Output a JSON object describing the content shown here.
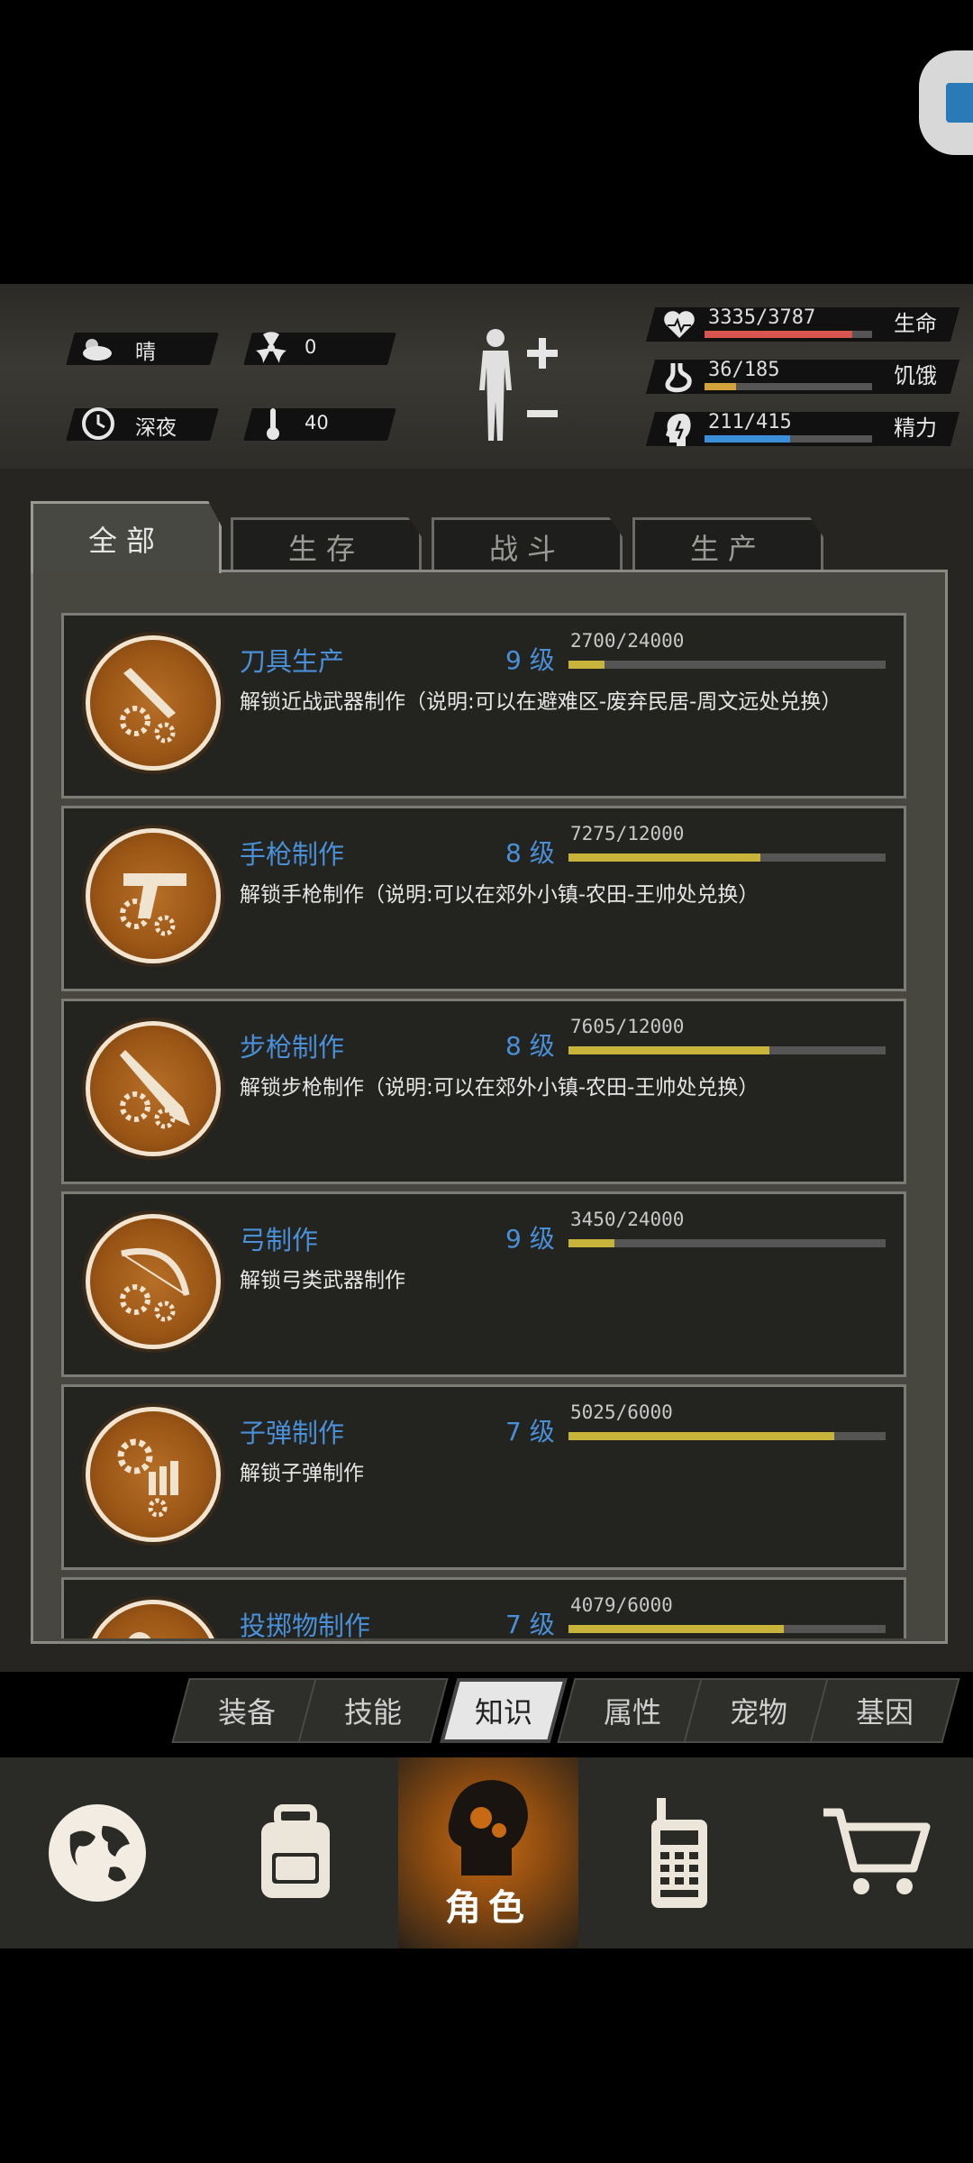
{
  "status": {
    "weather": "晴",
    "radiation": "0",
    "time_of_day": "深夜",
    "temperature": "40",
    "bars": [
      {
        "name": "生命",
        "value_text": "3335/3787",
        "fraction": 0.88,
        "color": "#d9534f",
        "icon": "heart-icon"
      },
      {
        "name": "饥饿",
        "value_text": "36/185",
        "fraction": 0.19,
        "color": "#d4a23a",
        "icon": "stomach-icon"
      },
      {
        "name": "精力",
        "value_text": "211/415",
        "fraction": 0.51,
        "color": "#3a8fd8",
        "icon": "brain-icon"
      }
    ]
  },
  "category_tabs": [
    {
      "label": "全部",
      "active": true
    },
    {
      "label": "生存",
      "active": false
    },
    {
      "label": "战斗",
      "active": false
    },
    {
      "label": "生产",
      "active": false
    }
  ],
  "skills": [
    {
      "name": "刀具生产",
      "level": "9 级",
      "progress_text": "2700/24000",
      "fraction": 0.1125,
      "desc": "解锁近战武器制作（说明:可以在避难区-废弃民居-周文远处兑换）",
      "icon": "knife-gear-icon"
    },
    {
      "name": "手枪制作",
      "level": "8 级",
      "progress_text": "7275/12000",
      "fraction": 0.606,
      "desc": "解锁手枪制作（说明:可以在郊外小镇-农田-王帅处兑换）",
      "icon": "pistol-gear-icon"
    },
    {
      "name": "步枪制作",
      "level": "8 级",
      "progress_text": "7605/12000",
      "fraction": 0.634,
      "desc": "解锁步枪制作（说明:可以在郊外小镇-农田-王帅处兑换）",
      "icon": "rifle-gear-icon"
    },
    {
      "name": "弓制作",
      "level": "9 级",
      "progress_text": "3450/24000",
      "fraction": 0.144,
      "desc": "解锁弓类武器制作",
      "icon": "bow-gear-icon"
    },
    {
      "name": "子弹制作",
      "level": "7 级",
      "progress_text": "5025/6000",
      "fraction": 0.8375,
      "desc": "解锁子弹制作",
      "icon": "bullet-gear-icon"
    },
    {
      "name": "投掷物制作",
      "level": "7 级",
      "progress_text": "4079/6000",
      "fraction": 0.68,
      "desc": "",
      "icon": "grenade-gear-icon"
    }
  ],
  "sub_tabs": [
    {
      "label": "装备",
      "active": false
    },
    {
      "label": "技能",
      "active": false
    },
    {
      "label": "知识",
      "active": true
    },
    {
      "label": "属性",
      "active": false
    },
    {
      "label": "宠物",
      "active": false
    },
    {
      "label": "基因",
      "active": false
    }
  ],
  "bottom_nav": [
    {
      "label": "",
      "icon": "globe-icon",
      "active": false
    },
    {
      "label": "",
      "icon": "backpack-icon",
      "active": false
    },
    {
      "label": "角色",
      "icon": "character-head-icon",
      "active": true
    },
    {
      "label": "",
      "icon": "walkie-talkie-icon",
      "active": false
    },
    {
      "label": "",
      "icon": "shopping-cart-icon",
      "active": false
    }
  ]
}
